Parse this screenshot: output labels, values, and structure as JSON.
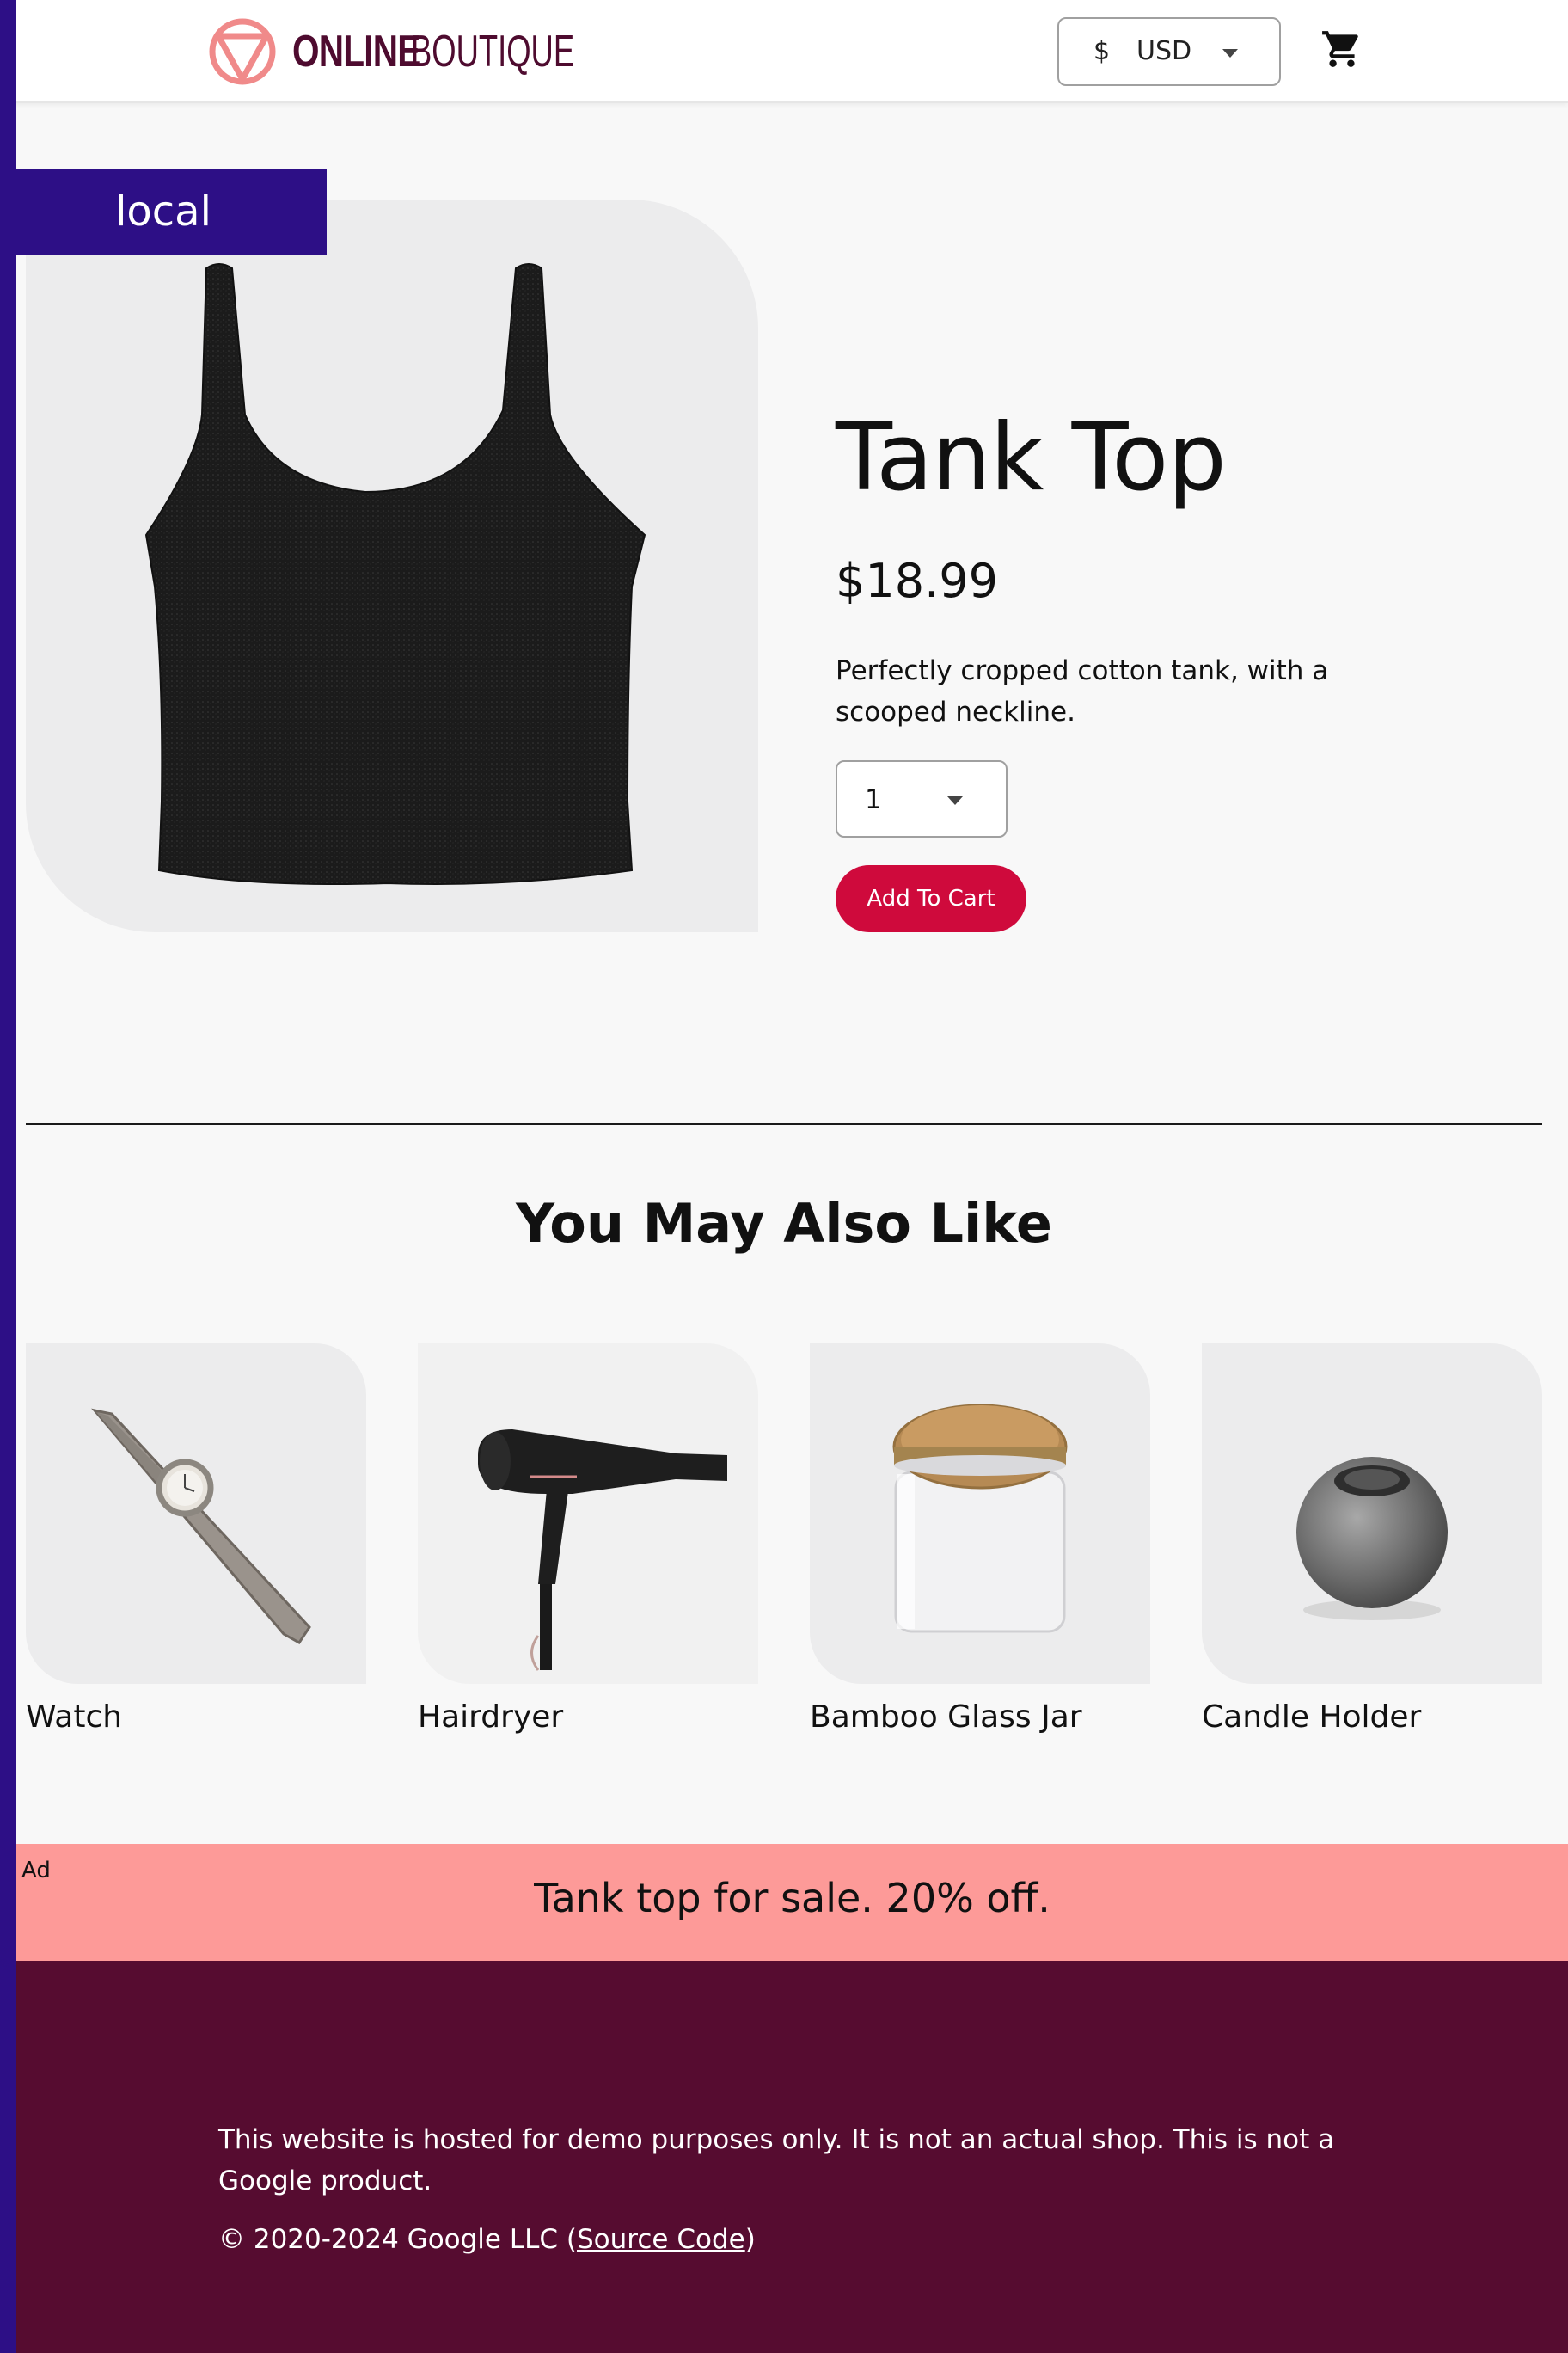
{
  "platform_banner": {
    "label": "local"
  },
  "header": {
    "logo": {
      "text_bold": "ONLINE",
      "text_light": "BOUTIQUE"
    },
    "currency": {
      "symbol": "$",
      "code": "USD"
    },
    "cart_icon": "shopping-cart-icon"
  },
  "product": {
    "title": "Tank Top",
    "price": "$18.99",
    "description": "Perfectly cropped cotton tank, with a scooped neckline.",
    "quantity": "1",
    "add_to_cart_label": "Add To Cart"
  },
  "recommendations": {
    "title": "You May Also Like",
    "items": [
      {
        "name": "Watch",
        "icon": "watch-image"
      },
      {
        "name": "Hairdryer",
        "icon": "hairdryer-image"
      },
      {
        "name": "Bamboo Glass Jar",
        "icon": "glass-jar-image"
      },
      {
        "name": "Candle Holder",
        "icon": "candle-holder-image"
      }
    ]
  },
  "ad": {
    "label": "Ad",
    "text": "Tank top for sale. 20% off."
  },
  "footer": {
    "note": "This website is hosted for demo purposes only. It is not an actual shop. This is not a Google product.",
    "copyright_prefix": "© 2020-2024 Google LLC (",
    "source_link": "Source Code",
    "copyright_suffix": ")"
  },
  "colors": {
    "accent_stripe": "#2d0f86",
    "button": "#cf0a3c",
    "ad_background": "#fd9a98",
    "footer_background": "#560c30",
    "brand_text": "#4e0b2f",
    "logo_mark": "#f08a8a"
  }
}
